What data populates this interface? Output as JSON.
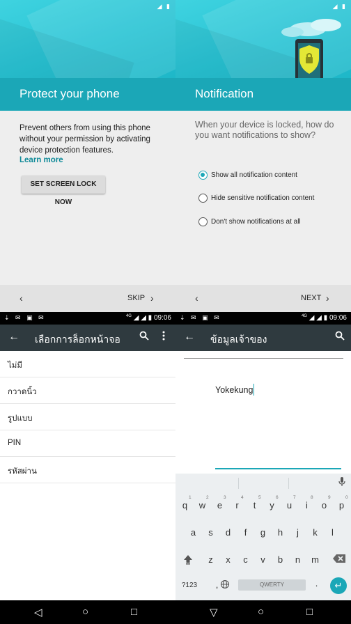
{
  "protect": {
    "title": "Protect your phone",
    "description": "Prevent others from using this phone without your permission by activating device protection features.",
    "learn_more": "Learn more",
    "screen_lock_button": "SET SCREEN LOCK NOW",
    "nav": {
      "back": "‹",
      "skip_label": "SKIP",
      "forward": "›"
    }
  },
  "notification": {
    "title": "Notification",
    "question": "When your device is locked, how do you want notifications to show?",
    "options": [
      {
        "label": "Show all notification content",
        "selected": true
      },
      {
        "label": "Hide sensitive notification content",
        "selected": false
      },
      {
        "label": "Don't show notifications at all",
        "selected": false
      }
    ],
    "nav": {
      "back": "‹",
      "next_label": "NEXT",
      "forward": "›"
    }
  },
  "statusbar": {
    "time": "09:06",
    "network": "4G"
  },
  "lock_screen": {
    "title": "เลือกการล็อกหน้าจอ",
    "items": [
      "ไม่มี",
      "กวาดนิ้ว",
      "รูปแบบ",
      "PIN",
      "รหัสผ่าน"
    ]
  },
  "owner_info": {
    "title": "ข้อมูลเจ้าของ",
    "value": "Yokekung"
  },
  "keyboard": {
    "row1": [
      "q",
      "w",
      "e",
      "r",
      "t",
      "y",
      "u",
      "i",
      "o",
      "p"
    ],
    "row1_hints": [
      "1",
      "2",
      "3",
      "4",
      "5",
      "6",
      "7",
      "8",
      "9",
      "0"
    ],
    "row2": [
      "a",
      "s",
      "d",
      "f",
      "g",
      "h",
      "j",
      "k",
      "l"
    ],
    "row3": [
      "z",
      "x",
      "c",
      "v",
      "b",
      "n",
      "m"
    ],
    "symbols_label": "?123",
    "comma": ",",
    "space_label": "QWERTY",
    "period": "."
  },
  "colors": {
    "accent": "#1ba7b7",
    "appbar": "#2f3a3f",
    "hero": "#27c2d3"
  }
}
